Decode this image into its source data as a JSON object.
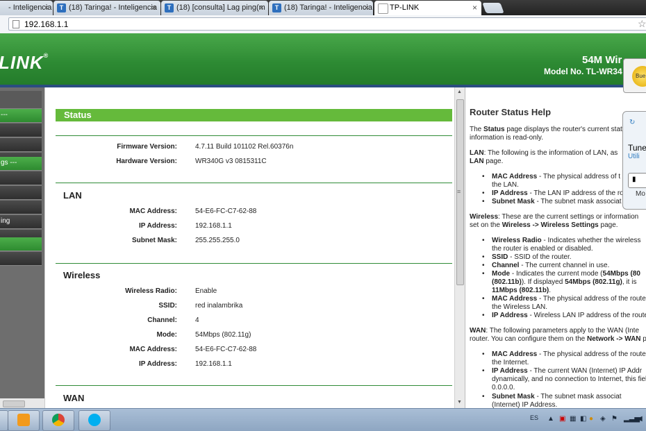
{
  "browser": {
    "tabs": [
      {
        "label": "- Inteligencia"
      },
      {
        "label": "(18) Taringa! - Inteligencia"
      },
      {
        "label": "(18) [consulta] Lag ping(m"
      },
      {
        "label": "(18) Taringa! - Inteligencia"
      },
      {
        "label": "TP-LINK"
      }
    ],
    "tab_favicon": "T",
    "tab_close": "×",
    "url": "192.168.1.1"
  },
  "header": {
    "logo": "LINK",
    "logo_mark": "®",
    "product": "54M Wir",
    "model": "Model No. TL-WR34"
  },
  "nav": {
    "items": [
      {
        "label": "---",
        "style": "green"
      },
      {
        "label": "",
        "style": "dark"
      },
      {
        "label": "",
        "style": "dark"
      },
      {
        "label": "",
        "style": "dark"
      },
      {
        "label": "gs ---",
        "style": "green"
      },
      {
        "label": "",
        "style": "dark"
      },
      {
        "label": "",
        "style": "dark"
      },
      {
        "label": "",
        "style": "dark"
      },
      {
        "label": "ing",
        "style": "dark"
      },
      {
        "label": "",
        "style": "dark"
      },
      {
        "label": "",
        "style": "green"
      },
      {
        "label": "",
        "style": "dark"
      }
    ]
  },
  "status": {
    "title": "Status",
    "firmware_label": "Firmware Version:",
    "firmware_value": "4.7.11 Build 101102 Rel.60376n",
    "hardware_label": "Hardware Version:",
    "hardware_value": "WR340G v3 0815311C",
    "lan": {
      "title": "LAN",
      "mac_label": "MAC Address:",
      "mac_value": "54-E6-FC-C7-62-88",
      "ip_label": "IP Address:",
      "ip_value": "192.168.1.1",
      "mask_label": "Subnet Mask:",
      "mask_value": "255.255.255.0"
    },
    "wireless": {
      "title": "Wireless",
      "radio_label": "Wireless Radio:",
      "radio_value": "Enable",
      "ssid_label": "SSID:",
      "ssid_value": "red inalambrika",
      "channel_label": "Channel:",
      "channel_value": "4",
      "mode_label": "Mode:",
      "mode_value": "54Mbps (802.11g)",
      "mac_label": "MAC Address:",
      "mac_value": "54-E6-FC-C7-62-88",
      "ip_label": "IP Address:",
      "ip_value": "192.168.1.1"
    },
    "wan": {
      "title": "WAN"
    }
  },
  "help": {
    "title": "Router Status Help",
    "p1a": "The ",
    "p1b": "Status",
    "p1c": " page displays the router's current stat",
    "p1d": "information is read-only.",
    "lan1": "LAN",
    "lan2": ": The following is the information of LAN, as",
    "lan3": "LAN",
    "lan4": " page.",
    "lb1a": "MAC Address",
    "lb1b": " - The physical address of t",
    "lb1c": "the LAN.",
    "lb2a": "IP Address",
    "lb2b": " - The LAN IP address of the rou",
    "lb3a": "Subnet Mask",
    "lb3b": " - The subnet mask associat",
    "w1": "Wireless",
    "w2": ": These are the current settings or information",
    "w3": "set on the ",
    "w4": "Wireless -> Wireless Settings",
    "w5": " page.",
    "wb1a": "Wireless Radio",
    "wb1b": " - Indicates whether the wireless",
    "wb1c": "the router is enabled or disabled.",
    "wb2a": "SSID",
    "wb2b": " - SSID of the router.",
    "wb3a": "Channel",
    "wb3b": " - The current channel in use.",
    "wb4a": "Mode",
    "wb4b": " - Indicates the current mode (",
    "wb4c": "54Mbps (80",
    "wb4d": "(802.11b)",
    "wb4e": "). If displayed ",
    "wb4f": "54Mbps (802.11g)",
    "wb4g": ", it is",
    "wb4h": "11Mbps (802.11b)",
    "wb4i": ".",
    "wb5a": "MAC Address",
    "wb5b": " - The physical address of the route",
    "wb5c": "the Wireless LAN.",
    "wb6a": "IP Address",
    "wb6b": " - Wireless LAN IP address of the route",
    "n1": "WAN",
    "n2": ": The following parameters apply to the WAN (Inte",
    "n3": "router. You can configure them on the ",
    "n4": "Network -> WAN",
    "n5": " pa",
    "nb1a": "MAC Address",
    "nb1b": " - The physical address of the route",
    "nb1c": "the Internet.",
    "nb2a": "IP Address",
    "nb2b": " - The current WAN (Internet) IP Addr",
    "nb2c": "dynamically, and no connection to Internet, this field",
    "nb2d": "0.0.0.0.",
    "nb3a": "Subnet Mask",
    "nb3b": " - The subnet mask associat",
    "nb3c": "(Internet) IP Address."
  },
  "popups": {
    "badge": "Bue",
    "tune": "Tune",
    "utili": "Utili",
    "mo": "Mo"
  },
  "taskbar": {
    "lang": "ES"
  },
  "colors": {
    "accent_green": "#65ba3b",
    "banner_green": "#2d8a33",
    "divider_green": "#2f8b36"
  }
}
